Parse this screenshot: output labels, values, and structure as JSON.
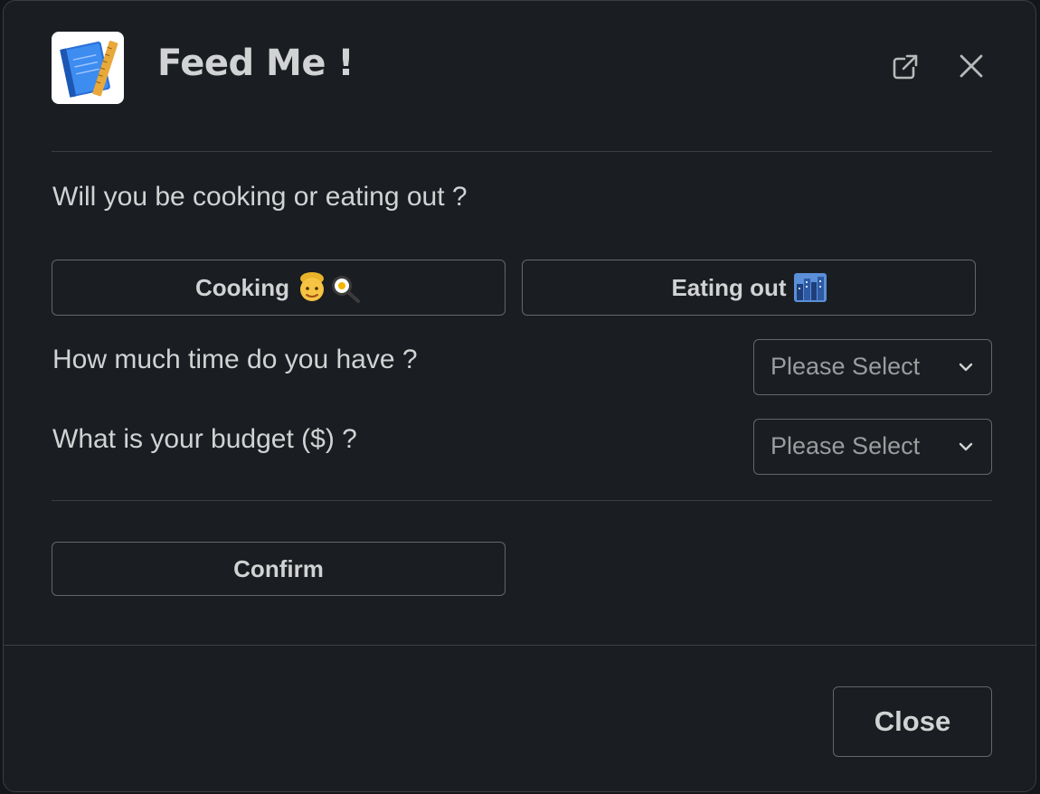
{
  "modal": {
    "title": "Feed Me !",
    "icons": {
      "app": "notebook-ruler-icon",
      "external": "external-link-icon",
      "close": "close-icon"
    }
  },
  "form": {
    "question_mode": "Will you be cooking or eating out ?",
    "choices": [
      {
        "label": "Cooking",
        "emoji": "man-and-frying-pan-emoji"
      },
      {
        "label": "Eating out",
        "emoji": "cityscape-emoji"
      }
    ],
    "question_time": "How much time do you have ?",
    "time_select": {
      "value": "Please Select"
    },
    "question_budget": "What is your budget ($) ?",
    "budget_select": {
      "value": "Please Select"
    },
    "confirm_label": "Confirm"
  },
  "footer": {
    "close_label": "Close"
  },
  "colors": {
    "background": "#1a1d21",
    "border": "#63666b",
    "text": "#d1d2d3",
    "muted": "#9b9c9e"
  }
}
